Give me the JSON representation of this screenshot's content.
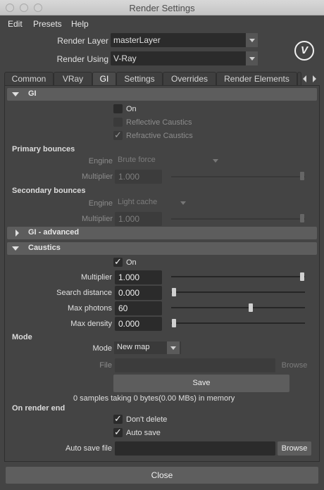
{
  "window": {
    "title": "Render Settings"
  },
  "menu": {
    "items": [
      "Edit",
      "Presets",
      "Help"
    ]
  },
  "header": {
    "render_layer_label": "Render Layer",
    "render_layer_value": "masterLayer",
    "render_using_label": "Render Using",
    "render_using_value": "V-Ray",
    "logo_icon": "vray-logo-icon",
    "logo_text": "V"
  },
  "tabs": [
    {
      "label": "Common"
    },
    {
      "label": "VRay"
    },
    {
      "label": "GI",
      "active": true
    },
    {
      "label": "Settings"
    },
    {
      "label": "Overrides"
    },
    {
      "label": "Render Elements"
    }
  ],
  "gi": {
    "section_title": "GI",
    "on_label": "On",
    "on_checked": false,
    "reflective_label": "Reflective Caustics",
    "reflective_checked": false,
    "refractive_label": "Refractive Caustics",
    "refractive_checked": true,
    "primary": {
      "title": "Primary bounces",
      "engine_label": "Engine",
      "engine_value": "Brute force",
      "multiplier_label": "Multiplier",
      "multiplier_value": "1.000",
      "multiplier_slider": 1.0
    },
    "secondary": {
      "title": "Secondary bounces",
      "engine_label": "Engine",
      "engine_value": "Light cache",
      "multiplier_label": "Multiplier",
      "multiplier_value": "1.000",
      "multiplier_slider": 1.0
    },
    "advanced_title": "GI - advanced"
  },
  "caustics": {
    "section_title": "Caustics",
    "on_label": "On",
    "on_checked": true,
    "multiplier_label": "Multiplier",
    "multiplier_value": "1.000",
    "multiplier_slider": 1.0,
    "search_distance_label": "Search distance",
    "search_distance_value": "0.000",
    "search_distance_slider": 0.0,
    "max_photons_label": "Max photons",
    "max_photons_value": "60",
    "max_photons_slider": 0.6,
    "max_density_label": "Max density",
    "max_density_value": "0.000",
    "max_density_slider": 0.0
  },
  "mode": {
    "title": "Mode",
    "mode_label": "Mode",
    "mode_value": "New map",
    "file_label": "File",
    "file_value": "",
    "browse_label": "Browse",
    "save_label": "Save",
    "memory_info": "0 samples taking 0 bytes(0.00 MBs) in memory"
  },
  "render_end": {
    "title": "On render end",
    "dont_delete_label": "Don't delete",
    "dont_delete_checked": true,
    "auto_save_label": "Auto save",
    "auto_save_checked": true,
    "auto_save_file_label": "Auto save file",
    "auto_save_file_value": "",
    "browse_label": "Browse"
  },
  "footer": {
    "close_label": "Close"
  }
}
